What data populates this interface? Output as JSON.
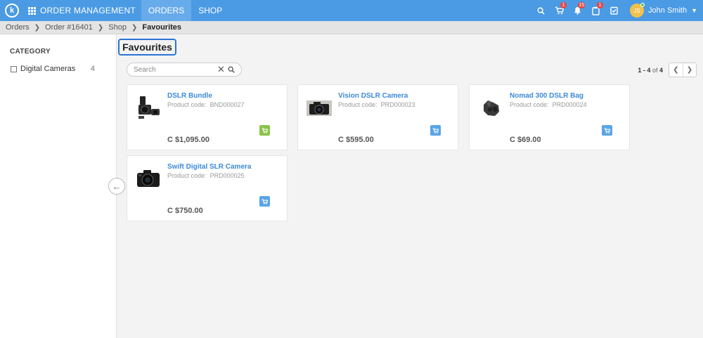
{
  "app": {
    "logo_letter": "k",
    "title": "ORDER MANAGEMENT",
    "tabs": [
      {
        "label": "ORDERS",
        "active": true
      },
      {
        "label": "SHOP",
        "active": false
      }
    ],
    "icons": [
      {
        "name": "search-icon",
        "badge": ""
      },
      {
        "name": "cart-icon",
        "badge": "1"
      },
      {
        "name": "bell-icon",
        "badge": "15"
      },
      {
        "name": "clipboard-icon",
        "badge": "1"
      },
      {
        "name": "tasks-icon",
        "badge": ""
      }
    ],
    "user": {
      "initials": "JS",
      "name": "John Smith"
    }
  },
  "breadcrumb": [
    "Orders",
    "Order #16401",
    "Shop",
    "Favourites"
  ],
  "sidebar": {
    "title": "CATEGORY",
    "categories": [
      {
        "label": "Digital Cameras",
        "count": "4"
      }
    ]
  },
  "main": {
    "title": "Favourites",
    "search": {
      "placeholder": "Search",
      "value": ""
    },
    "pager": {
      "range": "1 - 4",
      "of_label": "of",
      "total": "4"
    },
    "products": [
      {
        "name": "DSLR Bundle",
        "code_label": "Product code:",
        "code": "BND000027",
        "price": "C $1,095.00",
        "cart_color": "#8bc34a",
        "image": "camera-bundle"
      },
      {
        "name": "Vision DSLR Camera",
        "code_label": "Product code:",
        "code": "PRD000023",
        "price": "C $595.00",
        "cart_color": "#5aa5e6",
        "image": "camera"
      },
      {
        "name": "Nomad 300 DSLR Bag",
        "code_label": "Product code:",
        "code": "PRD000024",
        "price": "C $69.00",
        "cart_color": "#5aa5e6",
        "image": "bag"
      },
      {
        "name": "Swift Digital SLR Camera",
        "code_label": "Product code:",
        "code": "PRD000025",
        "price": "C $750.00",
        "cart_color": "#5aa5e6",
        "image": "camera"
      }
    ]
  },
  "colors": {
    "topbar": "#4a9ae4",
    "active_tab": "#68abea",
    "link": "#3c8ad8",
    "highlight_border": "#2b74d6"
  }
}
